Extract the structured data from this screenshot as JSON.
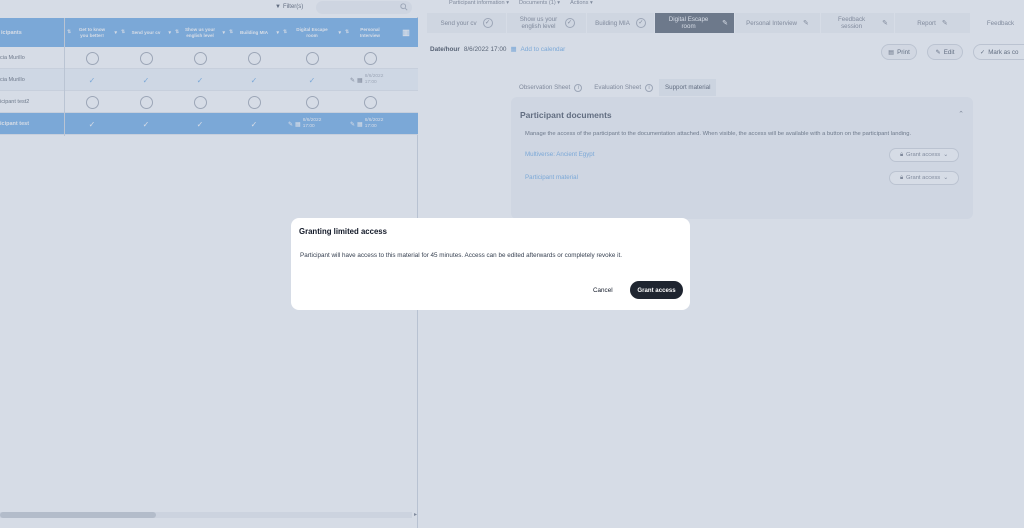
{
  "left": {
    "filter_label": "Filter(s)",
    "columns": [
      "icipants",
      "Get to know you better!",
      "Send your cv",
      "Show us your english level",
      "Building MIA",
      "Digital Escape room",
      "Personal Interview"
    ],
    "rows": [
      {
        "name": "cia Murillo",
        "cells": [
          "circle",
          "circle",
          "circle",
          "circle",
          "circle",
          "circle"
        ]
      },
      {
        "name": "cia Murillo",
        "cells": [
          "check",
          "check",
          "check",
          "check",
          "check",
          "date"
        ],
        "date": "8/6/2022 17:00"
      },
      {
        "name": "icipant test2",
        "cells": [
          "circle",
          "circle",
          "circle",
          "circle",
          "circle",
          "circle"
        ]
      },
      {
        "name": "icipant test",
        "cells": [
          "check",
          "check",
          "check",
          "check",
          "date",
          "date"
        ],
        "date": "8/6/2022 17:00",
        "selected": true
      }
    ]
  },
  "right": {
    "top_menu": [
      "Participant information ▾",
      "Documents (1) ▾",
      "Actions ▾"
    ],
    "stages": [
      {
        "label": "Send your cv",
        "state": "done"
      },
      {
        "label": "Show us your english level",
        "state": "done"
      },
      {
        "label": "Building MIA",
        "state": "done"
      },
      {
        "label": "Digital Escape room",
        "state": "active"
      },
      {
        "label": "Personal Interview",
        "state": "edit"
      },
      {
        "label": "Feedback session",
        "state": "edit"
      },
      {
        "label": "Report",
        "state": "edit"
      },
      {
        "label": "Feedback",
        "state": "plain"
      }
    ],
    "date_label": "Date/hour",
    "date_value": "8/6/2022 17:00",
    "add_calendar": "Add to calendar",
    "print_label": "Print",
    "edit_label": "Edit",
    "mark_label": "Mark as co",
    "subtabs": [
      "Observation Sheet",
      "Evaluation Sheet",
      "Support material"
    ],
    "panel_title": "Participant documents",
    "panel_desc": "Manage the access of the participant to the documentation attached. When visible, the access will be available with a button on the participant landing.",
    "docs": [
      {
        "name": "Multiverse: Ancient Egypt",
        "button": "Grant access"
      },
      {
        "name": "Participant material",
        "button": "Grant access"
      }
    ]
  },
  "modal": {
    "title": "Granting limited access",
    "body": "Participant will have access to this material for 45 minutes. Access can be edited afterwards or completely revoke it.",
    "cancel": "Cancel",
    "confirm": "Grant access"
  },
  "colors": {
    "accent": "#63a6e6",
    "dark": "#1f2530",
    "overlay": "rgba(158,171,196,0.42)"
  }
}
